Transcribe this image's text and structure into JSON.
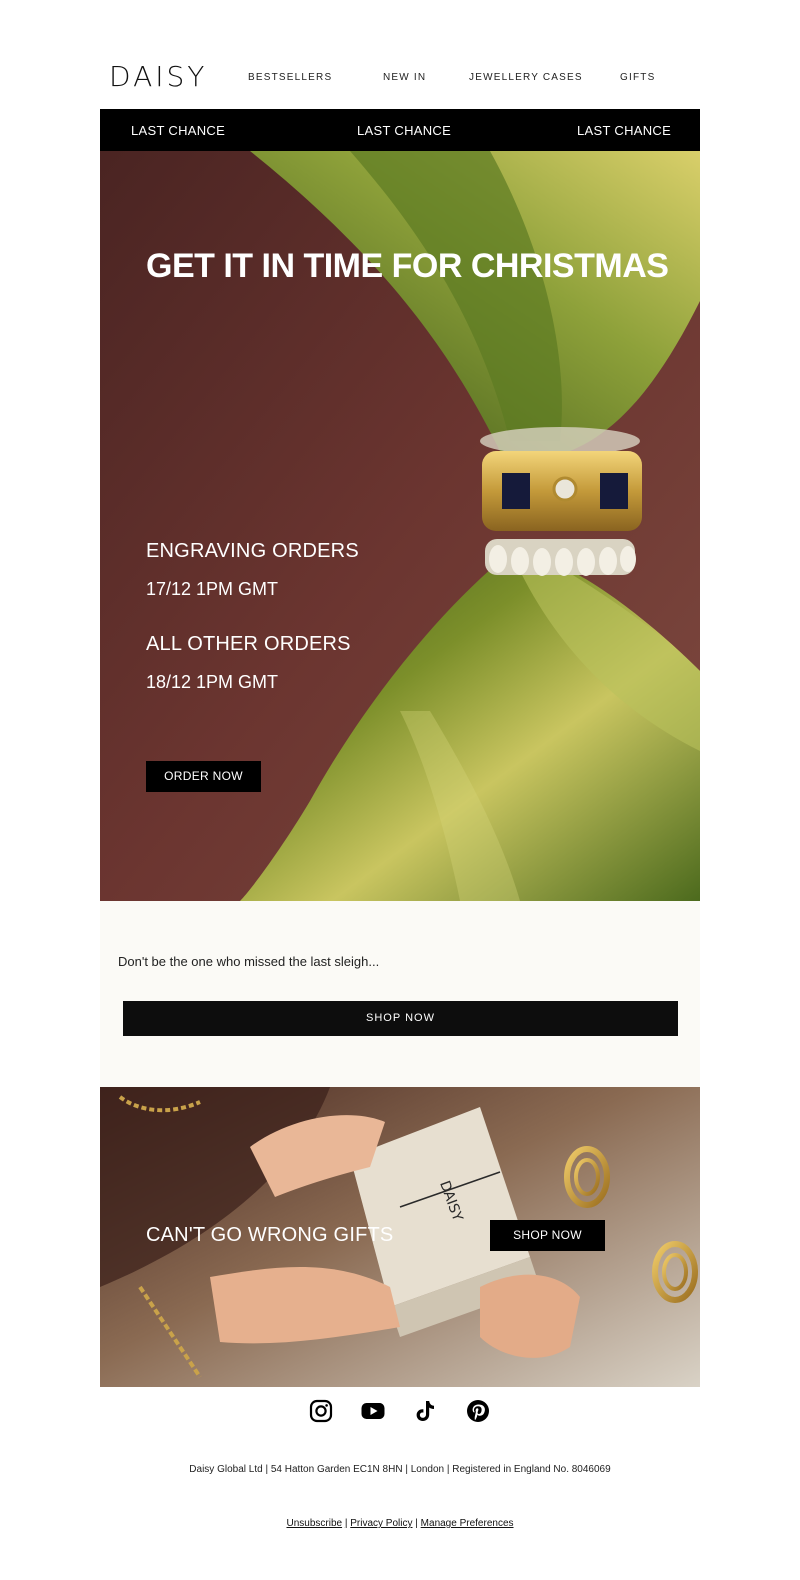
{
  "brand": {
    "logo": "DAISY"
  },
  "nav": [
    {
      "label": "BESTSELLERS"
    },
    {
      "label": "NEW IN"
    },
    {
      "label": "JEWELLERY CASES"
    },
    {
      "label": "GIFTS"
    }
  ],
  "announcement": [
    "LAST CHANCE",
    "LAST CHANCE",
    "LAST CHANCE"
  ],
  "hero": {
    "title": "GET IT IN TIME FOR CHRISTMAS",
    "engraving_heading": "ENGRAVING ORDERS",
    "engraving_date": "17/12 1PM GMT",
    "other_heading": "ALL OTHER ORDERS",
    "other_date": "18/12 1PM GMT",
    "cta": "ORDER NOW"
  },
  "promo": {
    "tagline": "Don't be the one who missed the last sleigh...",
    "cta": "SHOP NOW"
  },
  "gifts": {
    "title": "CAN'T GO WRONG GIFTS",
    "cta": "SHOP NOW",
    "box_text": "DAISY"
  },
  "social": [
    "instagram-icon",
    "youtube-icon",
    "tiktok-icon",
    "pinterest-icon"
  ],
  "footer": {
    "address": "Daisy Global Ltd | 54 Hatton Garden EC1N 8HN | London | Registered in England No. 8046069",
    "unsubscribe": "Unsubscribe",
    "privacy": "Privacy Policy",
    "preferences": "Manage Preferences",
    "separator": "|"
  },
  "colors": {
    "black": "#000000",
    "cream": "#fbfaf6",
    "white": "#ffffff"
  }
}
